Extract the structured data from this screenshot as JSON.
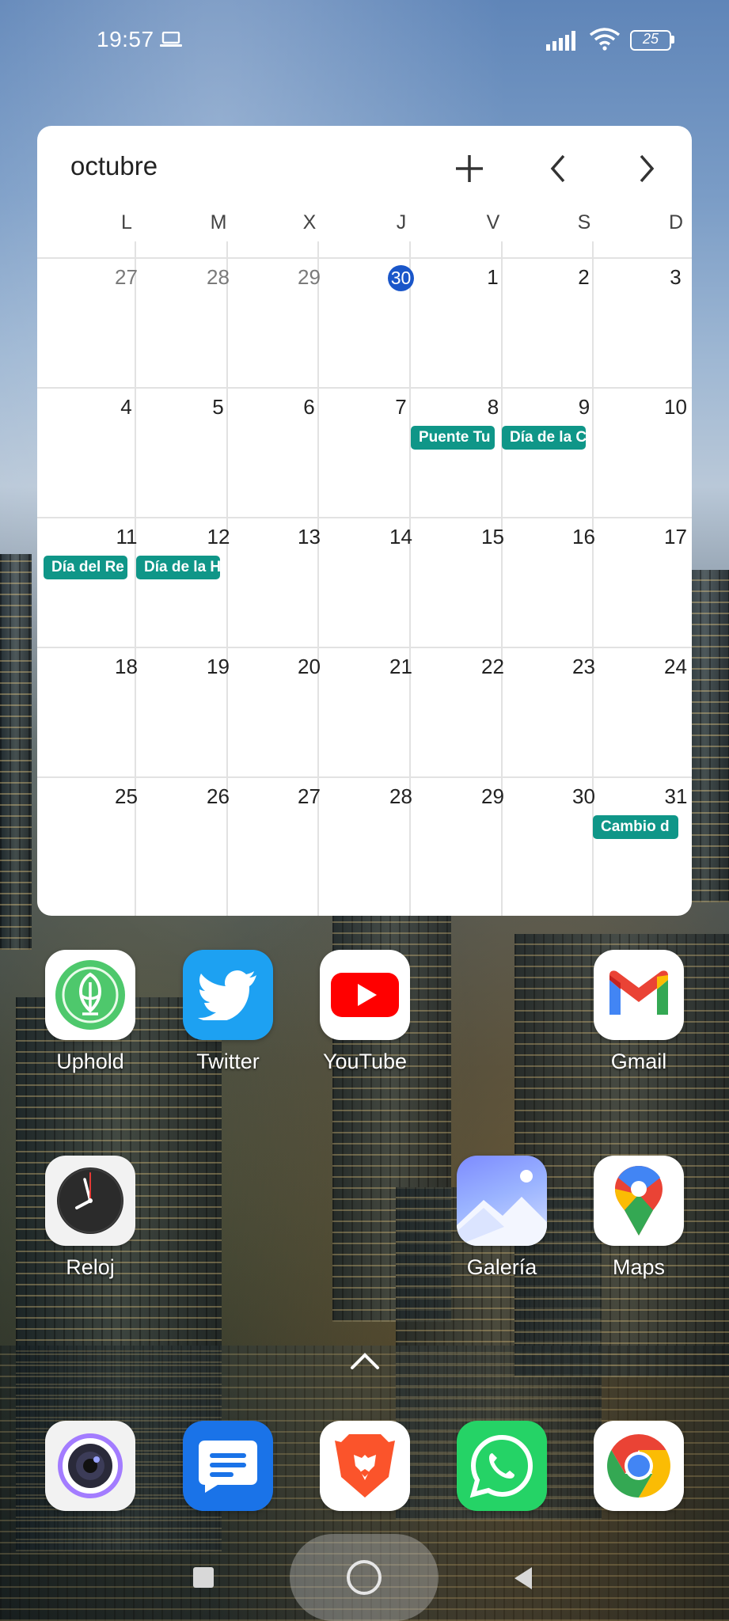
{
  "status_bar": {
    "time": "19:57",
    "battery": "25",
    "icons": [
      "laptop-icon",
      "signal-icon",
      "wifi-icon",
      "battery-icon"
    ]
  },
  "calendar": {
    "month": "octubre",
    "weekdays": [
      "L",
      "M",
      "X",
      "J",
      "V",
      "S",
      "D"
    ],
    "weeks": [
      [
        {
          "day": "27",
          "muted": true
        },
        {
          "day": "28",
          "muted": true
        },
        {
          "day": "29",
          "muted": true
        },
        {
          "day": "30",
          "today": true
        },
        {
          "day": "1"
        },
        {
          "day": "2"
        },
        {
          "day": "3"
        }
      ],
      [
        {
          "day": "4"
        },
        {
          "day": "5"
        },
        {
          "day": "6"
        },
        {
          "day": "7"
        },
        {
          "day": "8",
          "event": "Puente Tu"
        },
        {
          "day": "9",
          "event": "Día de la C"
        },
        {
          "day": "10"
        }
      ],
      [
        {
          "day": "11",
          "event": "Día del Re"
        },
        {
          "day": "12",
          "event": "Día de la H"
        },
        {
          "day": "13"
        },
        {
          "day": "14"
        },
        {
          "day": "15"
        },
        {
          "day": "16"
        },
        {
          "day": "17"
        }
      ],
      [
        {
          "day": "18"
        },
        {
          "day": "19"
        },
        {
          "day": "20"
        },
        {
          "day": "21"
        },
        {
          "day": "22"
        },
        {
          "day": "23"
        },
        {
          "day": "24"
        }
      ],
      [
        {
          "day": "25"
        },
        {
          "day": "26"
        },
        {
          "day": "27"
        },
        {
          "day": "28"
        },
        {
          "day": "29"
        },
        {
          "day": "30"
        },
        {
          "day": "31",
          "event": "Cambio d"
        }
      ]
    ],
    "colors": {
      "today": "#1a56c9",
      "event": "#0f9688"
    }
  },
  "apps": {
    "row1": {
      "uphold": "Uphold",
      "twitter": "Twitter",
      "youtube": "YouTube",
      "gmail": "Gmail"
    },
    "row2": {
      "reloj": "Reloj",
      "galeria": "Galería",
      "maps": "Maps"
    }
  },
  "dock": [
    "camera-icon",
    "messages-icon",
    "brave-icon",
    "whatsapp-icon",
    "chrome-icon"
  ]
}
